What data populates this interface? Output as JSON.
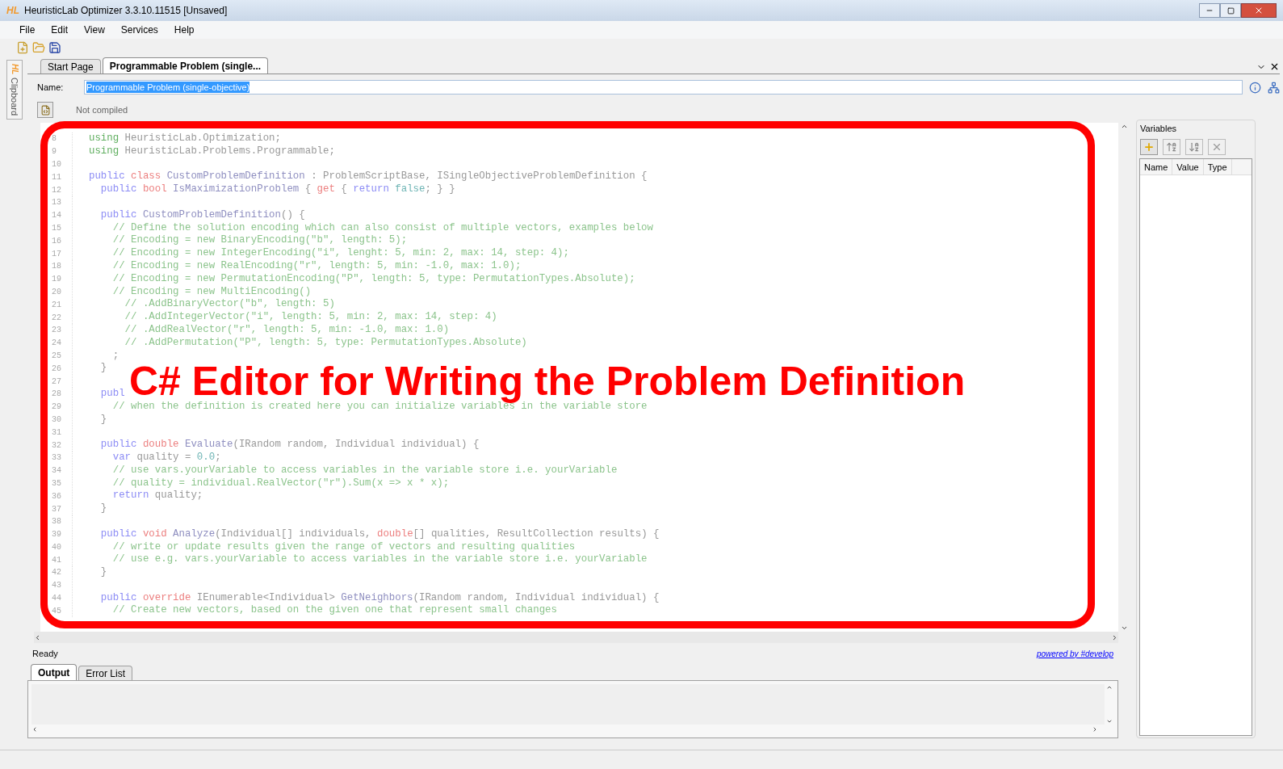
{
  "window": {
    "title": "HeuristicLab Optimizer 3.3.10.11515 [Unsaved]",
    "logo": "HL"
  },
  "menu": [
    "File",
    "Edit",
    "View",
    "Services",
    "Help"
  ],
  "sidebar": {
    "logo": "HL",
    "label": "Clipboard"
  },
  "tabs": [
    {
      "label": "Start Page",
      "selected": false
    },
    {
      "label": "Programmable Problem (single...",
      "selected": true
    }
  ],
  "name_field": {
    "label": "Name:",
    "value": "Programmable Problem (single-objective)"
  },
  "compile_status": "Not compiled",
  "editor": {
    "lines": [
      {
        "number": "8",
        "segments": [
          {
            "kind": "directive",
            "text": "using"
          },
          {
            "kind": "plain",
            "text": " HeuristicLab.Optimization;"
          }
        ]
      },
      {
        "number": "9",
        "segments": [
          {
            "kind": "directive",
            "text": "using"
          },
          {
            "kind": "plain",
            "text": " HeuristicLab.Problems.Programmable;"
          }
        ]
      },
      {
        "number": "10"
      },
      {
        "number": "11",
        "segments": [
          {
            "kind": "keyword",
            "text": "public"
          },
          {
            "kind": "type",
            "text": " class"
          },
          {
            "kind": "name",
            "text": " CustomProblemDefinition"
          },
          {
            "kind": "plain",
            "text": " : ProblemScriptBase, ISingleObjectiveProblemDefinition {"
          }
        ]
      },
      {
        "number": "12",
        "segments": [
          {
            "kind": "keyword",
            "text": "  public"
          },
          {
            "kind": "type",
            "text": " bool"
          },
          {
            "kind": "name",
            "text": " IsMaximizationProblem"
          },
          {
            "kind": "plain",
            "text": " { "
          },
          {
            "kind": "type",
            "text": "get"
          },
          {
            "kind": "plain",
            "text": " { "
          },
          {
            "kind": "keyword",
            "text": "return"
          },
          {
            "kind": "literal",
            "text": " false"
          },
          {
            "kind": "plain",
            "text": "; } }"
          }
        ]
      },
      {
        "number": "13"
      },
      {
        "number": "14",
        "segments": [
          {
            "kind": "keyword",
            "text": "  public"
          },
          {
            "kind": "name",
            "text": " CustomProblemDefinition"
          },
          {
            "kind": "plain",
            "text": "() {"
          }
        ]
      },
      {
        "number": "15",
        "segments": [
          {
            "kind": "comment",
            "text": "    // Define the solution encoding which can also consist of multiple vectors, examples below"
          }
        ]
      },
      {
        "number": "16",
        "segments": [
          {
            "kind": "comment",
            "text": "    // Encoding = new BinaryEncoding(\"b\", length: 5);"
          }
        ]
      },
      {
        "number": "17",
        "segments": [
          {
            "kind": "comment",
            "text": "    // Encoding = new IntegerEncoding(\"i\", lenght: 5, min: 2, max: 14, step: 4);"
          }
        ]
      },
      {
        "number": "18",
        "segments": [
          {
            "kind": "comment",
            "text": "    // Encoding = new RealEncoding(\"r\", length: 5, min: -1.0, max: 1.0);"
          }
        ]
      },
      {
        "number": "19",
        "segments": [
          {
            "kind": "comment",
            "text": "    // Encoding = new PermutationEncoding(\"P\", length: 5, type: PermutationTypes.Absolute);"
          }
        ]
      },
      {
        "number": "20",
        "segments": [
          {
            "kind": "comment",
            "text": "    // Encoding = new MultiEncoding()"
          }
        ]
      },
      {
        "number": "21",
        "segments": [
          {
            "kind": "comment",
            "text": "      // .AddBinaryVector(\"b\", length: 5)"
          }
        ]
      },
      {
        "number": "22",
        "segments": [
          {
            "kind": "comment",
            "text": "      // .AddIntegerVector(\"i\", length: 5, min: 2, max: 14, step: 4)"
          }
        ]
      },
      {
        "number": "23",
        "segments": [
          {
            "kind": "comment",
            "text": "      // .AddRealVector(\"r\", length: 5, min: -1.0, max: 1.0)"
          }
        ]
      },
      {
        "number": "24",
        "segments": [
          {
            "kind": "comment",
            "text": "      // .AddPermutation(\"P\", length: 5, type: PermutationTypes.Absolute)"
          }
        ]
      },
      {
        "number": "25",
        "segments": [
          {
            "kind": "plain",
            "text": "    ;"
          }
        ]
      },
      {
        "number": "26",
        "segments": [
          {
            "kind": "plain",
            "text": "  }"
          }
        ]
      },
      {
        "number": "27"
      },
      {
        "number": "28",
        "segments": [
          {
            "kind": "keyword",
            "text": "  publ"
          }
        ]
      },
      {
        "number": "29",
        "segments": [
          {
            "kind": "comment",
            "text": "    // when the definition is created here you can initialize variables in the variable store"
          }
        ]
      },
      {
        "number": "30",
        "segments": [
          {
            "kind": "plain",
            "text": "  }"
          }
        ]
      },
      {
        "number": "31"
      },
      {
        "number": "32",
        "segments": [
          {
            "kind": "keyword",
            "text": "  public"
          },
          {
            "kind": "type",
            "text": " double"
          },
          {
            "kind": "name",
            "text": " Evaluate"
          },
          {
            "kind": "plain",
            "text": "(IRandom random, Individual individual) {"
          }
        ]
      },
      {
        "number": "33",
        "segments": [
          {
            "kind": "keyword",
            "text": "    var"
          },
          {
            "kind": "plain",
            "text": " quality = "
          },
          {
            "kind": "literal",
            "text": "0.0"
          },
          {
            "kind": "plain",
            "text": ";"
          }
        ]
      },
      {
        "number": "34",
        "segments": [
          {
            "kind": "comment",
            "text": "    // use vars.yourVariable to access variables in the variable store i.e. yourVariable"
          }
        ]
      },
      {
        "number": "35",
        "segments": [
          {
            "kind": "comment",
            "text": "    // quality = individual.RealVector(\"r\").Sum(x => x * x);"
          }
        ]
      },
      {
        "number": "36",
        "segments": [
          {
            "kind": "keyword",
            "text": "    return"
          },
          {
            "kind": "plain",
            "text": " quality;"
          }
        ]
      },
      {
        "number": "37",
        "segments": [
          {
            "kind": "plain",
            "text": "  }"
          }
        ]
      },
      {
        "number": "38"
      },
      {
        "number": "39",
        "segments": [
          {
            "kind": "keyword",
            "text": "  public"
          },
          {
            "kind": "type",
            "text": " void"
          },
          {
            "kind": "name",
            "text": " Analyze"
          },
          {
            "kind": "plain",
            "text": "(Individual[] individuals, "
          },
          {
            "kind": "type",
            "text": "double"
          },
          {
            "kind": "plain",
            "text": "[] qualities, ResultCollection results) {"
          }
        ]
      },
      {
        "number": "40",
        "segments": [
          {
            "kind": "comment",
            "text": "    // write or update results given the range of vectors and resulting qualities"
          }
        ]
      },
      {
        "number": "41",
        "segments": [
          {
            "kind": "comment",
            "text": "    // use e.g. vars.yourVariable to access variables in the variable store i.e. yourVariable"
          }
        ]
      },
      {
        "number": "42",
        "segments": [
          {
            "kind": "plain",
            "text": "  }"
          }
        ]
      },
      {
        "number": "43"
      },
      {
        "number": "44",
        "segments": [
          {
            "kind": "keyword",
            "text": "  public"
          },
          {
            "kind": "type",
            "text": " override"
          },
          {
            "kind": "plain",
            "text": " IEnumerable<Individual> "
          },
          {
            "kind": "name",
            "text": "GetNeighbors"
          },
          {
            "kind": "plain",
            "text": "(IRandom random, Individual individual) {"
          }
        ]
      },
      {
        "number": "45",
        "segments": [
          {
            "kind": "comment",
            "text": "    // Create new vectors, based on the given one that represent small changes"
          }
        ]
      }
    ]
  },
  "variables": {
    "title": "Variables",
    "columns": [
      "Name",
      "Value",
      "Type"
    ]
  },
  "status": {
    "text": "Ready",
    "link": "powered by #develop"
  },
  "output_tabs": [
    {
      "label": "Output",
      "selected": true
    },
    {
      "label": "Error List",
      "selected": false
    }
  ],
  "annotation": {
    "text": "C# Editor for Writing the Problem Definition"
  }
}
